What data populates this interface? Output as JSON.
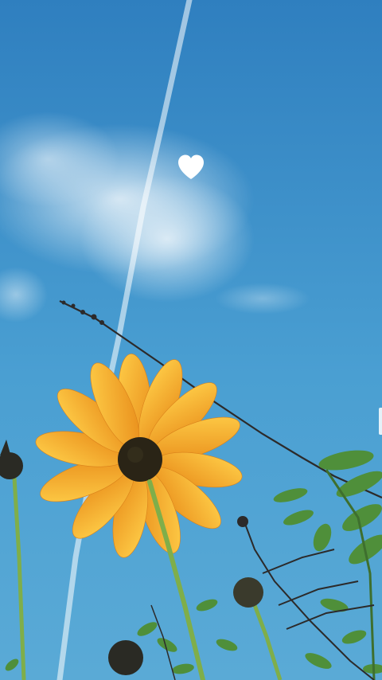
{
  "photo": {
    "subject": "sunflower-against-sky",
    "colors": {
      "sky_top": "#2f7fbf",
      "sky_bottom": "#5aaad6",
      "petal": "#f6b21e",
      "petal_dark": "#e8901a",
      "center": "#2a2416",
      "stem": "#7fae4a",
      "leaf": "#4f8f3a",
      "twig": "#2c2a2a"
    }
  },
  "overlay": {
    "like_icon": "heart-icon"
  }
}
